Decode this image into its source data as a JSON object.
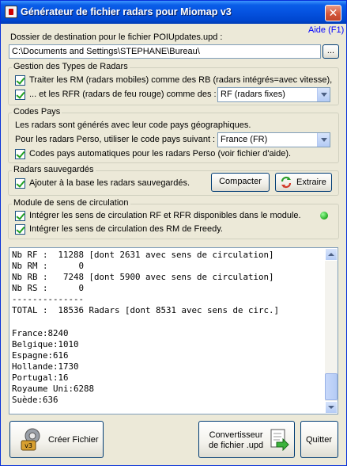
{
  "window": {
    "title": "Générateur de fichier radars pour Miomap v3"
  },
  "help_link": "Aide (F1)",
  "destination": {
    "label": "Dossier de destination pour le fichier POIUpdates.upd :",
    "value": "C:\\Documents and Settings\\STEPHANE\\Bureau\\",
    "browse_label": "..."
  },
  "types": {
    "legend": "Gestion des Types de Radars",
    "rm_label": "Traiter les RM (radars mobiles) comme des RB (radars intégrés=avec vitesse),",
    "rfr_label": "... et les RFR (radars de feu rouge) comme des :",
    "rfr_select": "RF (radars fixes)"
  },
  "codes": {
    "legend": "Codes Pays",
    "info": "Les radars sont générés avec leur code pays géographiques.",
    "perso_label": "Pour les radars Perso, utiliser le code pays suivant :",
    "perso_select": "France (FR)",
    "auto_label": "Codes pays automatiques pour les radars Perso (voir fichier d'aide)."
  },
  "saved": {
    "legend": "Radars sauvegardés",
    "add_label": "Ajouter à la base les radars sauvegardés.",
    "compact_button": "Compacter",
    "extract_button": "Extraire"
  },
  "module": {
    "legend": "Module de sens de circulation",
    "rf_label": "Intégrer les sens de circulation RF et RFR disponibles dans le module.",
    "rm_label": "Intégrer les sens de circulation des RM de Freedy."
  },
  "log_lines": [
    "Nb RF :  11288 [dont 2631 avec sens de circulation]",
    "Nb RM :      0",
    "Nb RB :   7248 [dont 5900 avec sens de circulation]",
    "Nb RS :      0",
    "--------------",
    "TOTAL :  18536 Radars [dont 8531 avec sens de circ.]",
    "",
    "France:8240",
    "Belgique:1010",
    "Espagne:616",
    "Hollande:1730",
    "Portugal:16",
    "Royaume Uni:6288",
    "Suède:636"
  ],
  "buttons": {
    "create": "Créer Fichier",
    "converter_line1": "Convertisseur",
    "converter_line2": "de fichier .upd",
    "quit": "Quitter"
  },
  "colors": {
    "titlebar": "#0552e0",
    "face": "#ece9d8",
    "link": "#0000ff",
    "status": "#22aa22"
  }
}
